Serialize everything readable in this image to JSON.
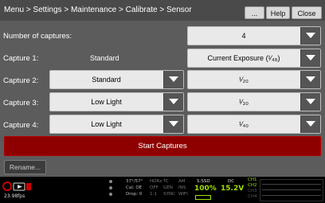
{
  "header": {
    "breadcrumb": "Menu > Settings > Maintenance > Calibrate > Sensor",
    "more_label": "...",
    "help_label": "Help",
    "close_label": "Close"
  },
  "form": {
    "num_captures_label": "Number of captures:",
    "num_captures_value": "4",
    "captures": [
      {
        "label": "Capture 1:",
        "type": "Standard",
        "exposure": "Current Exposure (¹⁄₄₈)"
      },
      {
        "label": "Capture 2:",
        "type": "Standard",
        "exposure": "¹⁄₂₀"
      },
      {
        "label": "Capture 3:",
        "type": "Low Light",
        "exposure": "¹⁄₃₀"
      },
      {
        "label": "Capture 4:",
        "type": "Low Light",
        "exposure": "¹⁄₄₀"
      }
    ],
    "start_label": "Start Captures",
    "rename_label": "Rename..."
  },
  "status": {
    "fps": "23.98fps",
    "col1": [
      "37°/57°",
      "Cal: OE",
      "Drop: 0"
    ],
    "col2": [
      "HDRx",
      "OFF",
      "1:1"
    ],
    "col3": [
      "TC",
      "GEN",
      "SYNC"
    ],
    "col4": [
      "AM",
      "INS",
      "WIFI"
    ],
    "ssd_label": "S:SSD",
    "ssd_value": "100%",
    "dc_label": "DC",
    "dc_value": "15.2V",
    "channels": [
      "CH1",
      "CH2",
      "CH3",
      "CH4"
    ]
  },
  "colors": {
    "accent_red": "#8e0000",
    "status_green": "#9fe000",
    "record_red": "#cc0000"
  }
}
